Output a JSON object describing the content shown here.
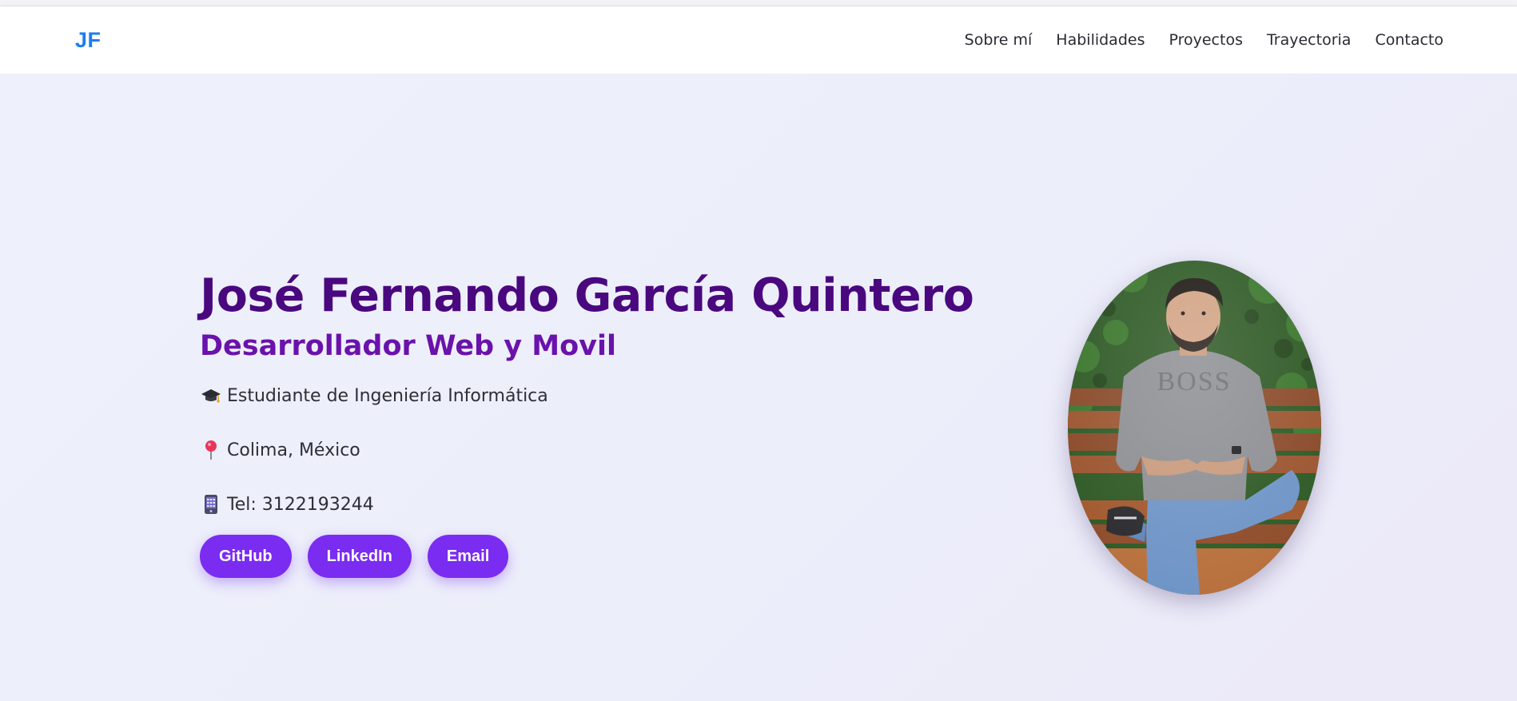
{
  "nav": {
    "logo": "JF",
    "links": [
      "Sobre mí",
      "Habilidades",
      "Proyectos",
      "Trayectoria",
      "Contacto"
    ]
  },
  "hero": {
    "name": "José Fernando García Quintero",
    "role": "Desarrollador Web y Movil",
    "info": [
      {
        "icon": "graduation-cap-icon",
        "text": "Estudiante de Ingeniería Informática"
      },
      {
        "icon": "location-pin-icon",
        "text": "Colima, México"
      },
      {
        "icon": "phone-icon",
        "text": "Tel: 3122193244"
      }
    ],
    "buttons": [
      "GitHub",
      "LinkedIn",
      "Email"
    ],
    "photo": "profile-photo"
  },
  "colors": {
    "logo": "#1e7df0",
    "name": "#4a087f",
    "role": "#6a12ab",
    "button": "#7a2cf0",
    "background": "#eceefa"
  }
}
